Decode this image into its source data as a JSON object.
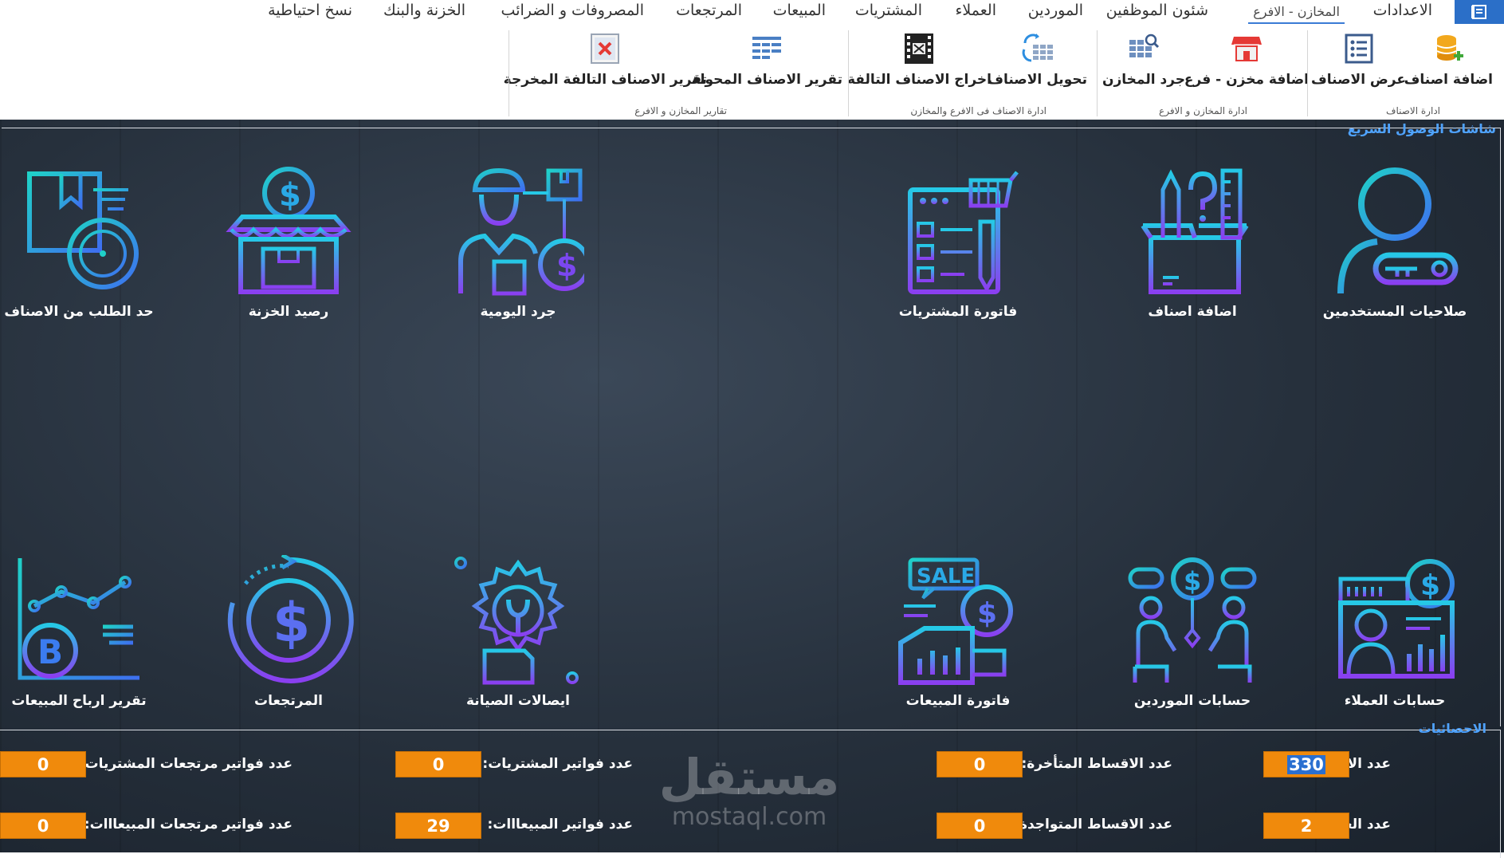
{
  "tabs": [
    {
      "label": "الاعدادات"
    },
    {
      "label": "المخازن - الافرع",
      "active": true
    },
    {
      "label": "شئون الموظفين"
    },
    {
      "label": "الموردين"
    },
    {
      "label": "العملاء"
    },
    {
      "label": "المشتريات"
    },
    {
      "label": "المبيعات"
    },
    {
      "label": "المرتجعات"
    },
    {
      "label": "المصروفات و الضرائب"
    },
    {
      "label": "الخزنة والبنك"
    },
    {
      "label": "نسخ احتياطية"
    }
  ],
  "ribbon": {
    "buttons": [
      {
        "label": "اضافة اصناف",
        "icon": "database-add-icon"
      },
      {
        "label": "عرض الاصناف",
        "icon": "list-icon"
      },
      {
        "label": "اضافة مخزن - فرع",
        "icon": "store-icon"
      },
      {
        "label": "جرد المخازن",
        "icon": "grid-search-icon"
      },
      {
        "label": "تحويل الاصناف",
        "icon": "transfer-icon"
      },
      {
        "label": "اخراج الاصناف التالفة",
        "icon": "film-cut-icon"
      },
      {
        "label": "تقرير الاصناف المحولة",
        "icon": "table-report-icon"
      },
      {
        "label": "تقرير الاصناف التالفة المخرجة",
        "icon": "delete-report-icon"
      }
    ],
    "groups": [
      {
        "label": "ادارة الاصناف"
      },
      {
        "label": "ادارة المخازن و الافرع"
      },
      {
        "label": "ادارة الاصناف فى الافرع والمخازن"
      },
      {
        "label": "تقارير المخازن و الافرع"
      }
    ]
  },
  "quick_access": {
    "title": "شاشات الوصول السريع",
    "tiles": [
      {
        "label": "صلاحيات المستخدمين",
        "icon": "user-key-icon"
      },
      {
        "label": "اضافة اصناف",
        "icon": "box-tools-icon"
      },
      {
        "label": "فاتورة المشتريات",
        "icon": "purchase-invoice-icon"
      },
      {
        "label": "جرد اليومية",
        "icon": "worker-inventory-icon"
      },
      {
        "label": "رصيد الخزنة",
        "icon": "shop-dollar-icon"
      },
      {
        "label": "حد الطلب من الاصناف",
        "icon": "box-stopwatch-icon"
      },
      {
        "label": "حسابات العملاء",
        "icon": "customer-account-icon"
      },
      {
        "label": "حسابات الموردين",
        "icon": "supplier-meeting-icon"
      },
      {
        "label": "فاتورة المبيعات",
        "icon": "sale-invoice-icon"
      },
      {
        "label": "ايصالات الصيانة",
        "icon": "maintenance-gear-icon"
      },
      {
        "label": "المرتجعات",
        "icon": "dollar-refresh-icon"
      },
      {
        "label": "تقرير ارباح المبيعات",
        "icon": "profit-chart-icon"
      }
    ]
  },
  "statistics": {
    "title": "الاحصائيات",
    "items": [
      {
        "label": "عدد الاصناف:",
        "value": "330"
      },
      {
        "label": "عدد العملاااء:",
        "value": "2"
      },
      {
        "label": "عدد الاقساط المتأخرة:",
        "value": "0"
      },
      {
        "label": "عدد الاقساط المتواجدة:",
        "value": "0"
      },
      {
        "label": "عدد فواتير المشتريات:",
        "value": "0"
      },
      {
        "label": "عدد فواتير المبيعااات:",
        "value": "29"
      },
      {
        "label": "عدد فواتير مرتجعات المشتريات:",
        "value": "0"
      },
      {
        "label": "عدد فواتير مرتجعات المبيعااات:",
        "value": "0"
      }
    ]
  },
  "watermark": {
    "arabic": "مستقل",
    "latin": "mostaql.com"
  },
  "colors": {
    "accent": "#2b6fc8",
    "stat_box": "#f08a0c",
    "frame_title": "#4fa3ff"
  }
}
